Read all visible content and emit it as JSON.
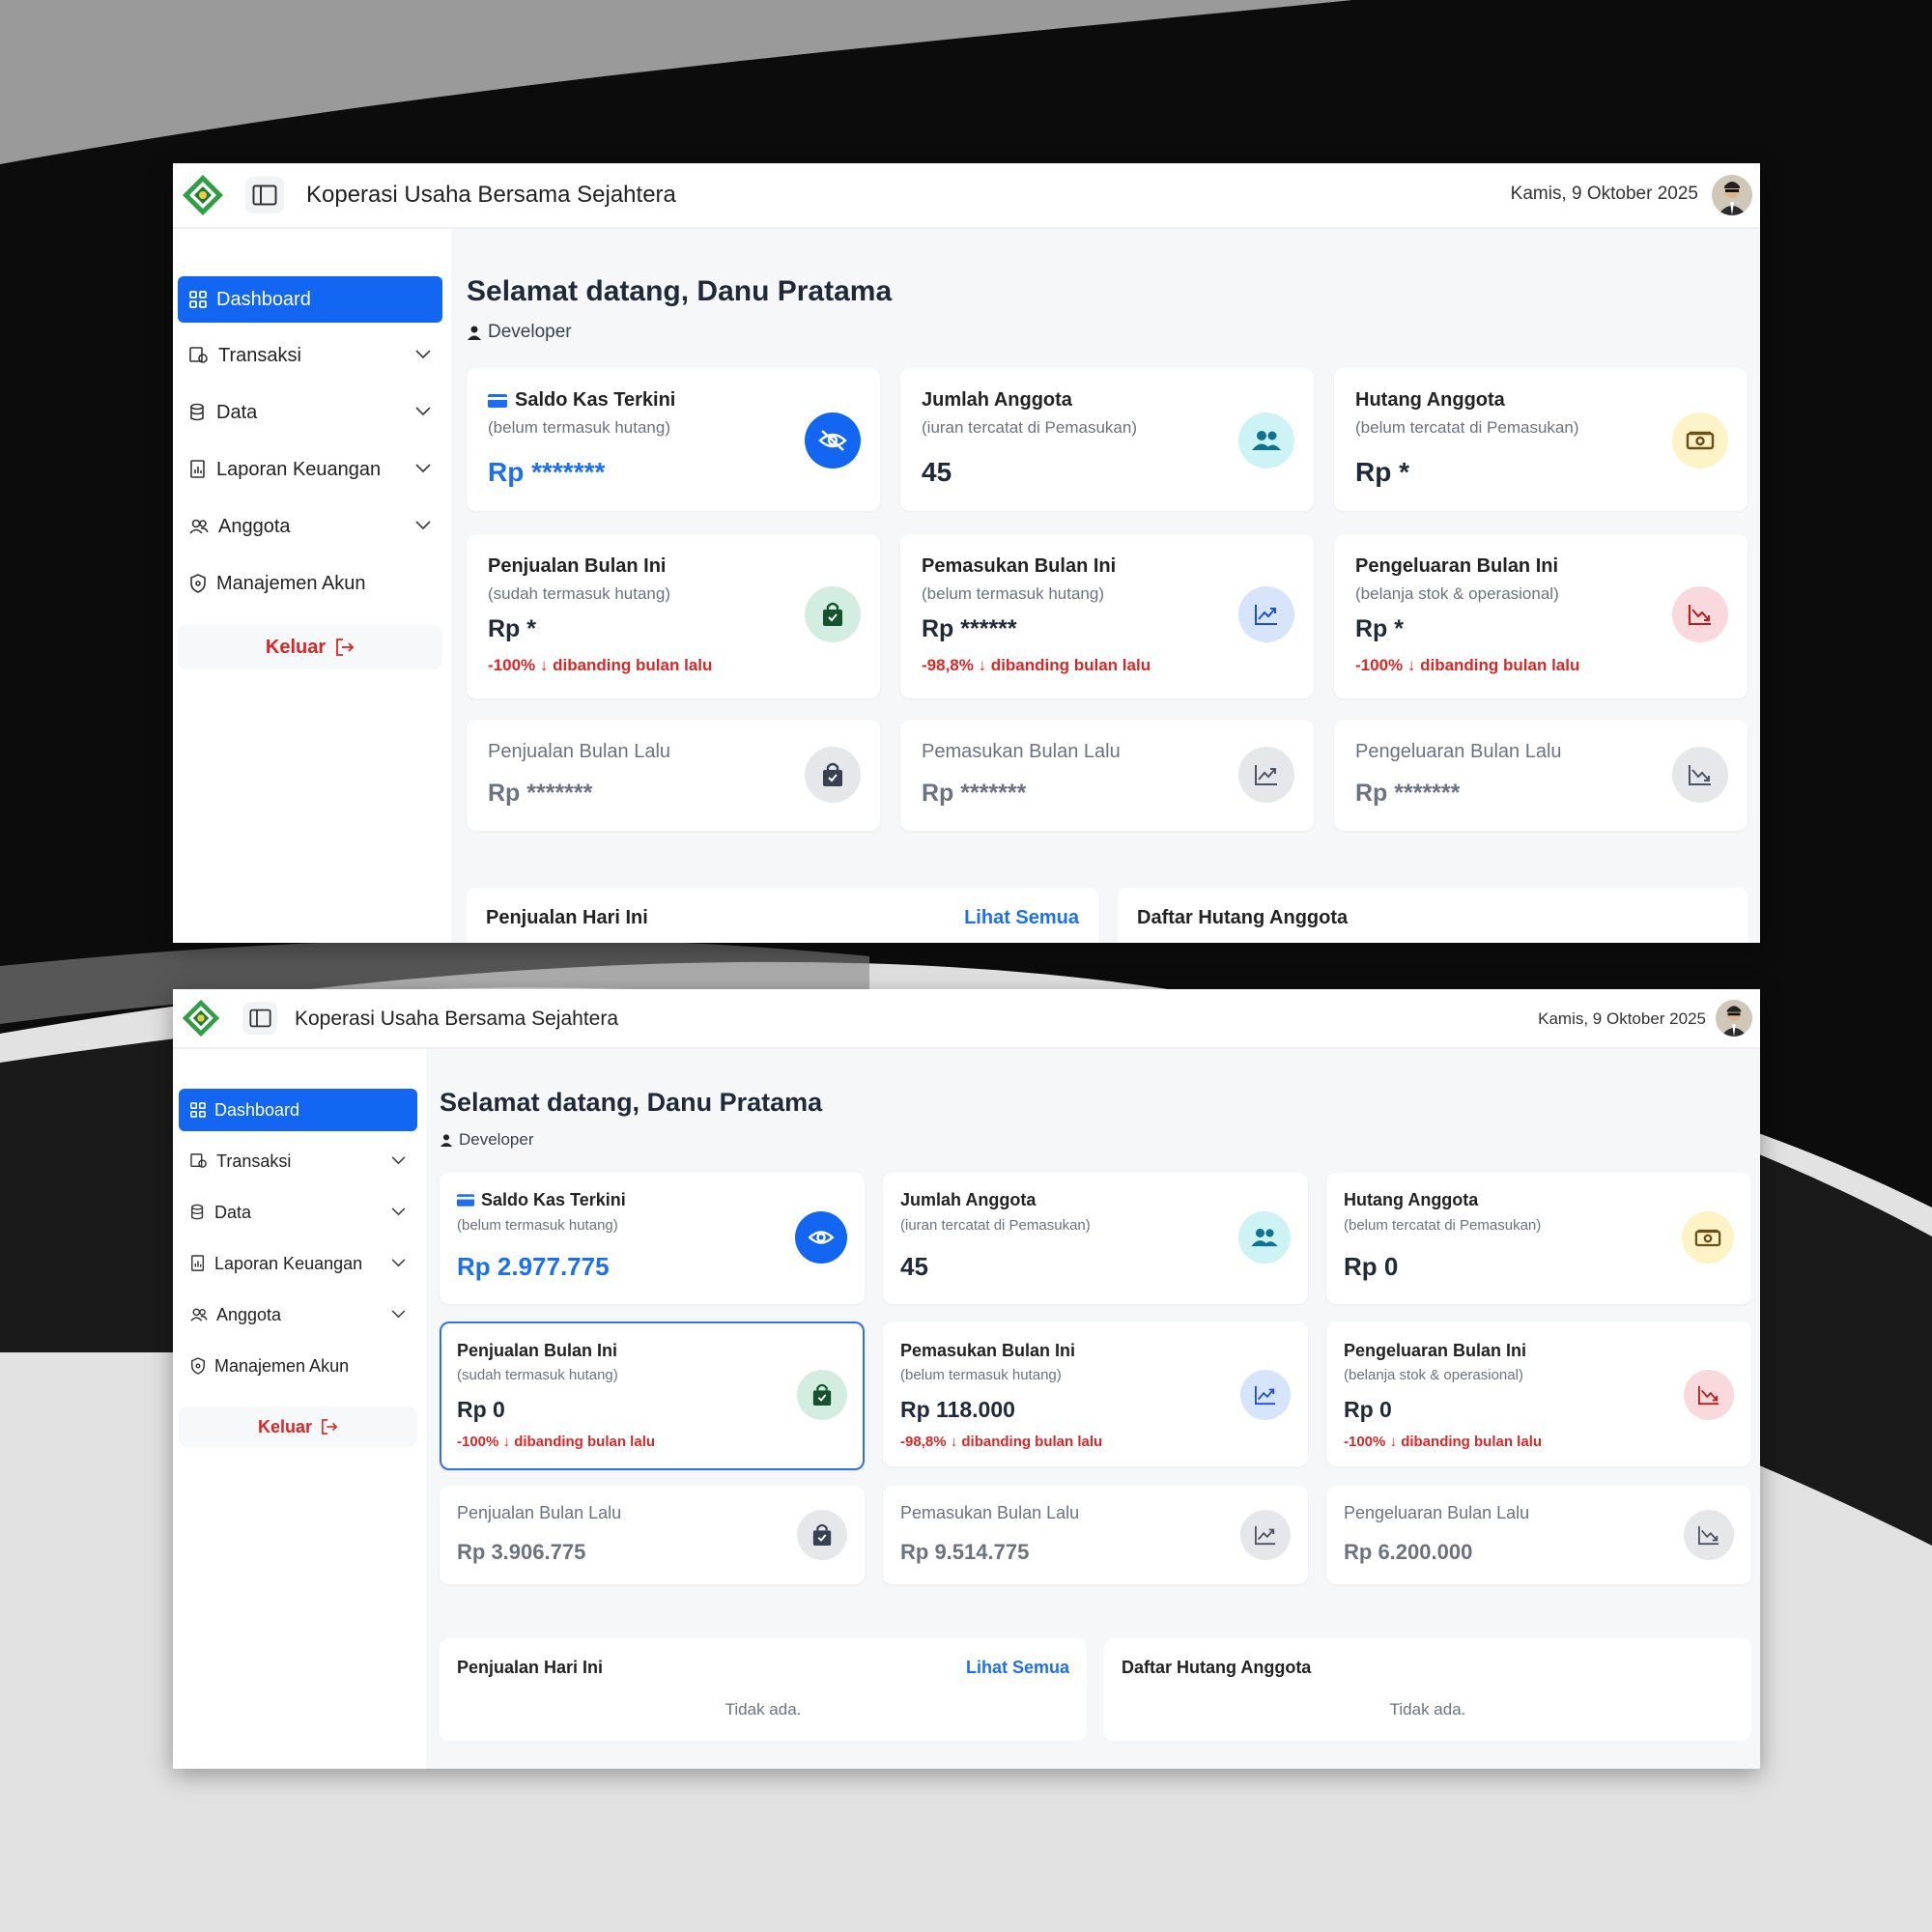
{
  "app": {
    "title": "Koperasi Usaha Bersama Sejahtera",
    "date": "Kamis, 9 Oktober 2025"
  },
  "sidebar": {
    "items": [
      {
        "label": "Dashboard",
        "icon": "grid-icon",
        "active": true,
        "expandable": false
      },
      {
        "label": "Transaksi",
        "icon": "receipt-icon",
        "active": false,
        "expandable": true
      },
      {
        "label": "Data",
        "icon": "database-icon",
        "active": false,
        "expandable": true
      },
      {
        "label": "Laporan Keuangan",
        "icon": "report-icon",
        "active": false,
        "expandable": true
      },
      {
        "label": "Anggota",
        "icon": "users-icon",
        "active": false,
        "expandable": true
      },
      {
        "label": "Manajemen Akun",
        "icon": "shield-icon",
        "active": false,
        "expandable": false
      }
    ],
    "logout": "Keluar"
  },
  "welcome": {
    "title": "Selamat datang, Danu Pratama",
    "role": "Developer"
  },
  "cards_labels": {
    "saldo": {
      "title": "Saldo Kas Terkini",
      "sub": "(belum termasuk hutang)"
    },
    "anggota": {
      "title": "Jumlah Anggota",
      "sub": "(iuran tercatat di Pemasukan)"
    },
    "hutang": {
      "title": "Hutang Anggota",
      "sub": "(belum tercatat di Pemasukan)"
    },
    "penjualan": {
      "title": "Penjualan Bulan Ini",
      "sub": "(sudah termasuk hutang)"
    },
    "pemasukan": {
      "title": "Pemasukan Bulan Ini",
      "sub": "(belum termasuk hutang)"
    },
    "pengeluaran": {
      "title": "Pengeluaran Bulan Ini",
      "sub": "(belanja stok & operasional)"
    },
    "penjualan_lalu": {
      "title": "Penjualan Bulan Lalu"
    },
    "pemasukan_lalu": {
      "title": "Pemasukan Bulan Lalu"
    },
    "pengeluaran_lalu": {
      "title": "Pengeluaran Bulan Lalu"
    }
  },
  "hidden_view": {
    "saldo": "Rp *******",
    "anggota": "45",
    "hutang": "Rp *",
    "penjualan": "Rp *",
    "penjualan_change": "-100% ↓ dibanding bulan lalu",
    "pemasukan": "Rp ******",
    "pemasukan_change": "-98,8% ↓ dibanding bulan lalu",
    "pengeluaran": "Rp *",
    "pengeluaran_change": "-100% ↓ dibanding bulan lalu",
    "penjualan_lalu": "Rp *******",
    "pemasukan_lalu": "Rp *******",
    "pengeluaran_lalu": "Rp *******"
  },
  "visible_view": {
    "saldo": "Rp 2.977.775",
    "anggota": "45",
    "hutang": "Rp 0",
    "penjualan": "Rp 0",
    "penjualan_change": "-100% ↓ dibanding bulan lalu",
    "pemasukan": "Rp 118.000",
    "pemasukan_change": "-98,8% ↓ dibanding bulan lalu",
    "pengeluaran": "Rp 0",
    "pengeluaran_change": "-100% ↓ dibanding bulan lalu",
    "penjualan_lalu": "Rp 3.906.775",
    "pemasukan_lalu": "Rp 9.514.775",
    "pengeluaran_lalu": "Rp 6.200.000"
  },
  "panels": {
    "penjualan_hari_ini": "Penjualan Hari Ini",
    "lihat_semua": "Lihat Semua",
    "daftar_hutang": "Daftar Hutang Anggota",
    "empty": "Tidak ada."
  },
  "colors": {
    "accent": "#1266f1",
    "danger": "#dc2626"
  }
}
